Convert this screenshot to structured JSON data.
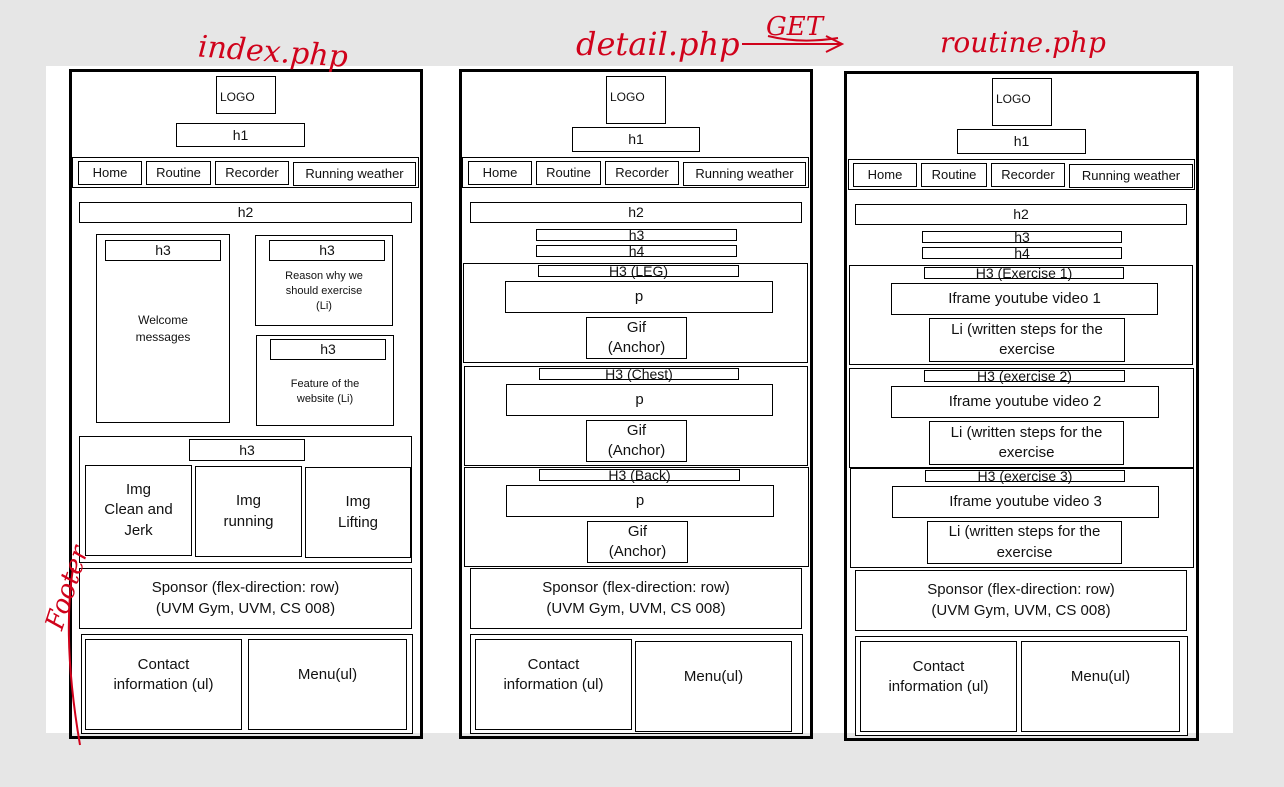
{
  "annotations": {
    "page1": "index.php",
    "page2": "detail.php",
    "page2_method": "GET",
    "page3": "routine.php",
    "margin_note": "Footer"
  },
  "common": {
    "logo": "LOGO",
    "h1": "h1",
    "h2": "h2",
    "h3": "h3",
    "h4": "h4",
    "nav": [
      "Home",
      "Routine",
      "Recorder",
      "Running weather"
    ],
    "sponsor_line1": "Sponsor (flex-direction: row)",
    "sponsor_line2": "(UVM Gym, UVM, CS 008)",
    "contact_line1": "Contact",
    "contact_line2": "information (ul)",
    "menu": "Menu(ul)"
  },
  "index": {
    "welcome_line1": "Welcome",
    "welcome_line2": "messages",
    "reason_line1": "Reason why we",
    "reason_line2": "should exercise",
    "reason_line3": "(Li)",
    "feature_line1": "Feature of the",
    "feature_line2": "website (Li)",
    "img1": [
      "Img",
      "Clean and",
      "Jerk"
    ],
    "img2": [
      "Img",
      "running"
    ],
    "img3": [
      "Img",
      "Lifting"
    ]
  },
  "detail": {
    "sections": [
      {
        "title": "H3 (LEG)",
        "p": "p",
        "gif1": "Gif",
        "gif2": "(Anchor)"
      },
      {
        "title": "H3 (Chest)",
        "p": "p",
        "gif1": "Gif",
        "gif2": "(Anchor)"
      },
      {
        "title": "H3 (Back)",
        "p": "p",
        "gif1": "Gif",
        "gif2": "(Anchor)"
      }
    ]
  },
  "routine": {
    "sections": [
      {
        "title": "H3 (Exercise 1)",
        "video": "Iframe youtube video 1",
        "li1": "Li (written steps for the",
        "li2": "exercise"
      },
      {
        "title": "H3 (exercise 2)",
        "video": "Iframe youtube video 2",
        "li1": "Li (written steps for the",
        "li2": "exercise"
      },
      {
        "title": "H3 (exercise 3)",
        "video": "Iframe youtube video 3",
        "li1": "Li (written steps for the",
        "li2": "exercise"
      }
    ]
  },
  "colors": {
    "ink": "#d0021b",
    "line": "#000000",
    "paper": "#ffffff",
    "background": "#e6e6e6"
  }
}
